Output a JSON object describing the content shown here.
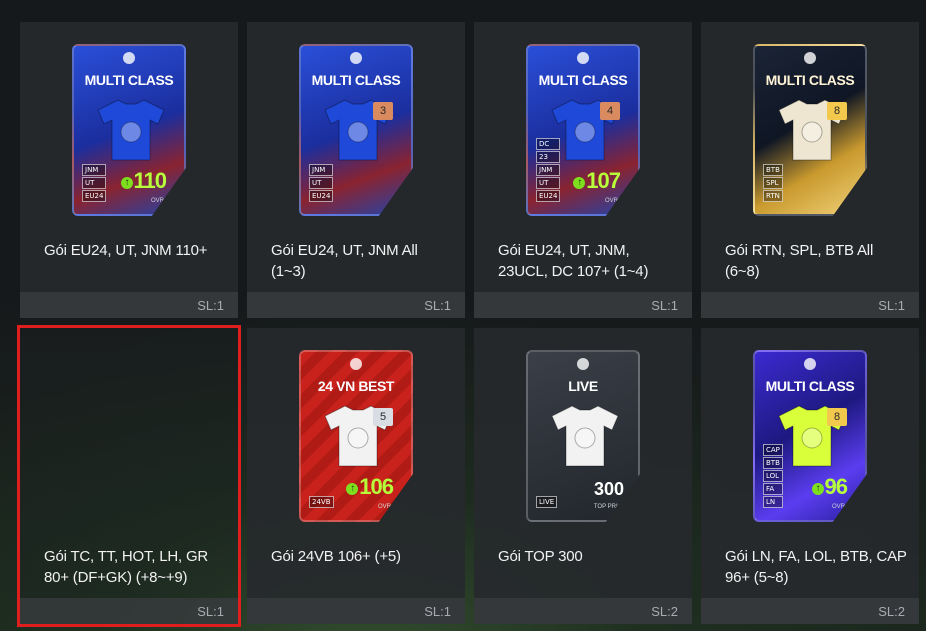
{
  "packs": [
    {
      "name": "Gói EU24, UT, JNM 110+",
      "quantity": "SL:1",
      "card": {
        "title": "MULTI CLASS",
        "style": "blue",
        "shirt_color": "#1f49d8",
        "badge": "",
        "badge_color": "",
        "tags": [
          "JNM",
          "UT",
          "EU24"
        ],
        "ovr": "110",
        "ovr_label": "OVR"
      }
    },
    {
      "name": "Gói EU24, UT, JNM All (1~3)",
      "quantity": "SL:1",
      "card": {
        "title": "MULTI CLASS",
        "style": "blue",
        "shirt_color": "#1f49d8",
        "badge": "3",
        "badge_color": "#d98a5e",
        "tags": [
          "JNM",
          "UT",
          "EU24"
        ],
        "ovr": "",
        "ovr_label": ""
      }
    },
    {
      "name": "Gói EU24, UT, JNM, 23UCL, DC 107+ (1~4)",
      "quantity": "SL:1",
      "card": {
        "title": "MULTI CLASS",
        "style": "blue",
        "shirt_color": "#1f49d8",
        "badge": "4",
        "badge_color": "#d98a5e",
        "tags": [
          "DC",
          "23",
          "JNM",
          "UT",
          "EU24"
        ],
        "ovr": "107",
        "ovr_label": "OVR"
      }
    },
    {
      "name": "Gói RTN, SPL, BTB All (6~8)",
      "quantity": "SL:1",
      "card": {
        "title": "MULTI CLASS",
        "style": "gold",
        "shirt_color": "#efe6d2",
        "badge": "8",
        "badge_color": "#f2c94c",
        "tags": [
          "BTB",
          "SPL",
          "RTN"
        ],
        "ovr": "",
        "ovr_label": ""
      }
    },
    {
      "name": "Gói TC, TT, HOT, LH, GR 80+ (DF+GK) (+8~+9)",
      "quantity": "SL:1",
      "selected": true,
      "card": null
    },
    {
      "name": "Gói 24VB 106+ (+5)",
      "quantity": "SL:1",
      "card": {
        "title": "24 VN BEST",
        "style": "red",
        "shirt_color": "#f2f2f2",
        "badge": "5",
        "badge_color": "#d8dde3",
        "tags": [
          "24VB"
        ],
        "ovr": "106",
        "ovr_label": "OVR"
      }
    },
    {
      "name": "Gói TOP 300",
      "quantity": "SL:2",
      "card": {
        "title": "LIVE",
        "style": "dark",
        "shirt_color": "#f2f2f2",
        "badge": "",
        "badge_color": "",
        "tags": [
          "LIVE"
        ],
        "top_price": "300",
        "top_price_label": "TOP PRICE"
      }
    },
    {
      "name": "Gói LN, FA, LOL, BTB, CAP 96+ (5~8)",
      "quantity": "SL:2",
      "card": {
        "title": "MULTI CLASS",
        "style": "purple",
        "shirt_color": "#d8ff3a",
        "badge": "8",
        "badge_color": "#f2c94c",
        "tags": [
          "CAP",
          "BTB",
          "LOL",
          "FA",
          "LN"
        ],
        "ovr": "96",
        "ovr_label": "OVR"
      }
    }
  ],
  "colors": {
    "selection_outline": "#e01e1e",
    "ovr_green": "#b6ff3a",
    "tile_bg": "#26292c"
  },
  "icons": {
    "trophy": "trophy-icon",
    "shirt": "shirt-icon",
    "ovr_up": "arrow-up-icon"
  }
}
